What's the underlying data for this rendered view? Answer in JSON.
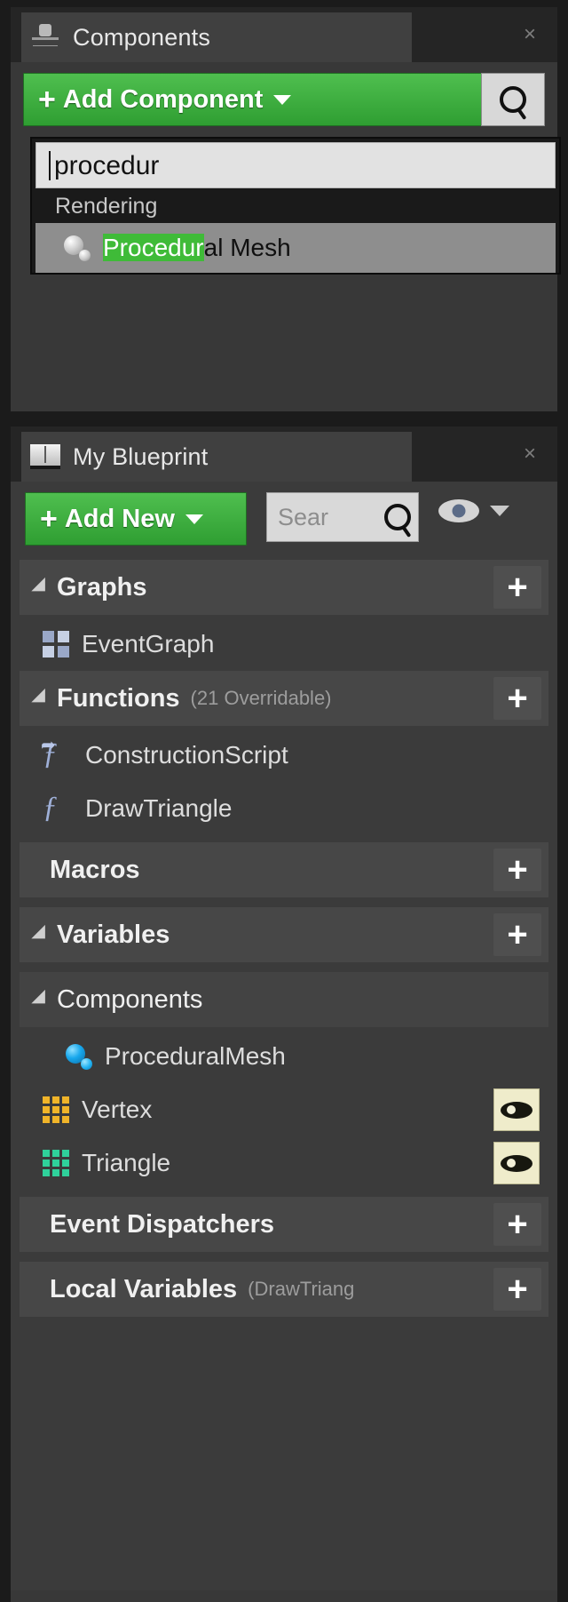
{
  "components_panel": {
    "tab": {
      "title": "Components",
      "icon": "components-gizmo-icon",
      "close": "×"
    },
    "add_button": {
      "label": "Add Component",
      "plus": "+"
    },
    "search_icon": "search-icon",
    "dropdown": {
      "search_value": "procedur",
      "category": "Rendering",
      "items": [
        {
          "highlight": "Procedur",
          "rest": "al Mesh",
          "icon": "mesh-sphere-icon"
        }
      ]
    }
  },
  "blueprint_panel": {
    "tab": {
      "title": "My Blueprint",
      "icon": "book-icon",
      "close": "×"
    },
    "add_new_button": {
      "label": "Add New",
      "plus": "+"
    },
    "search": {
      "placeholder": "Sear"
    },
    "eye_toggle": "visibility-eye-icon",
    "sections": {
      "graphs": {
        "label": "Graphs",
        "add": "+",
        "items": [
          {
            "label": "EventGraph",
            "icon": "event-graph-icon"
          }
        ]
      },
      "functions": {
        "label": "Functions",
        "sub": "(21 Overridable)",
        "add": "+",
        "items": [
          {
            "label": "ConstructionScript",
            "icon": "construction-script-icon"
          },
          {
            "label": "DrawTriangle",
            "icon": "function-icon"
          }
        ]
      },
      "macros": {
        "label": "Macros",
        "add": "+"
      },
      "variables": {
        "label": "Variables",
        "add": "+"
      },
      "components": {
        "label": "Components",
        "items": [
          {
            "label": "ProceduralMesh",
            "icon": "mesh-sphere-icon",
            "eye": false
          },
          {
            "label": "Vertex",
            "icon": "array-icon-yellow",
            "eye": true
          },
          {
            "label": "Triangle",
            "icon": "array-icon-teal",
            "eye": true
          }
        ]
      },
      "event_dispatchers": {
        "label": "Event Dispatchers",
        "add": "+"
      },
      "local_variables": {
        "label": "Local Variables",
        "sub": "(DrawTriang",
        "add": "+"
      }
    }
  },
  "colors": {
    "green_button": "#3fa83f",
    "highlight_green": "#3fbb38",
    "panel_bg": "#383838",
    "yellow_array": "#f0b429",
    "teal_array": "#2fd19b",
    "blue_sphere": "#17a7ec"
  }
}
